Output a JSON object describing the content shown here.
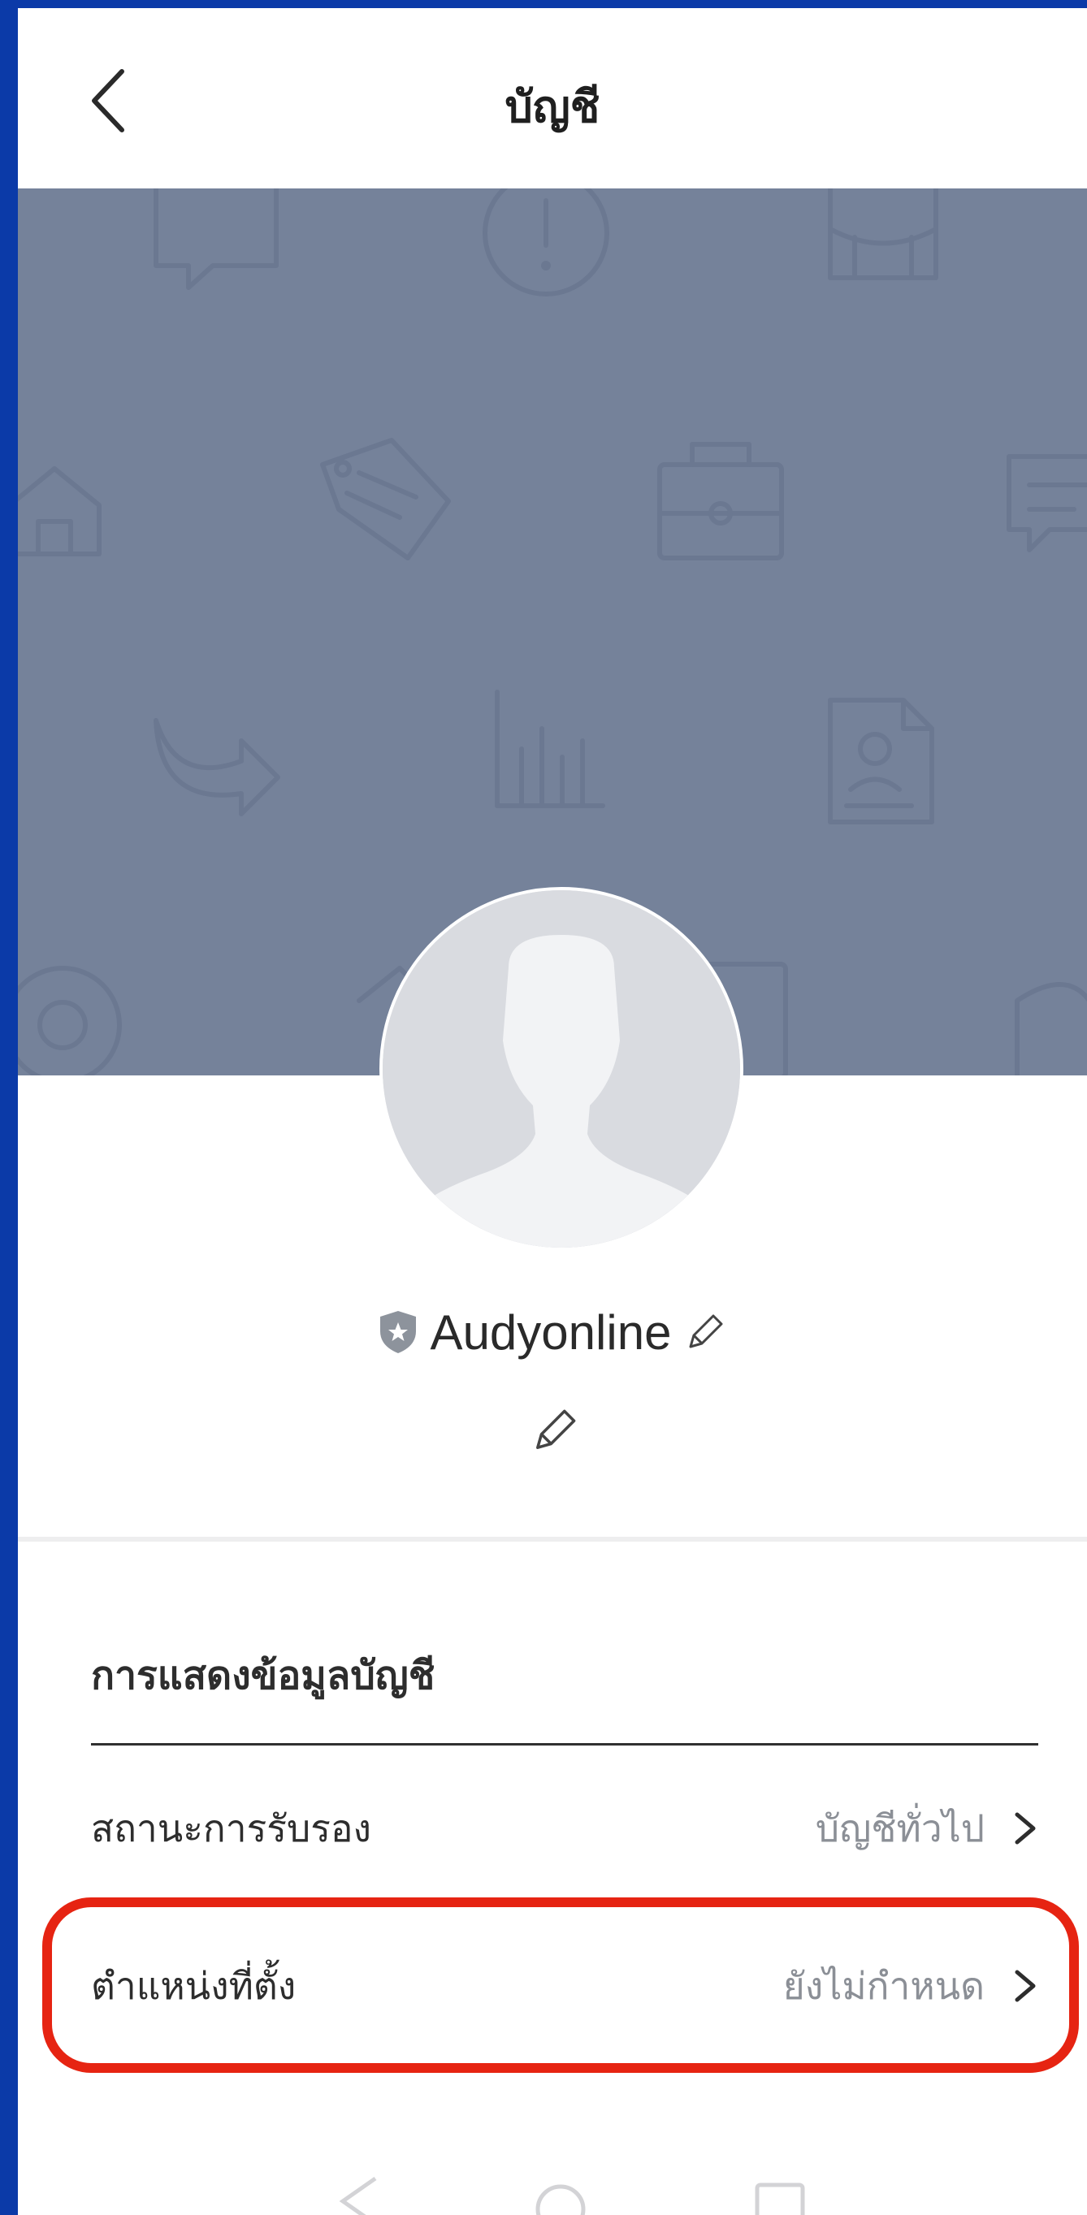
{
  "header": {
    "title": "บัญชี"
  },
  "profile": {
    "name": "Audyonline"
  },
  "section": {
    "title": "การแสดงข้อมูลบัญชี",
    "rows": [
      {
        "label": "สถานะการรับรอง",
        "value": "บัญชีทั่วไป"
      },
      {
        "label": "ตำแหน่งที่ตั้ง",
        "value": "ยังไม่กำหนด"
      }
    ]
  },
  "colors": {
    "frame": "#0b3aa8",
    "cover": "#75829a",
    "highlight": "#e62412",
    "value_text": "#8b8f96"
  }
}
